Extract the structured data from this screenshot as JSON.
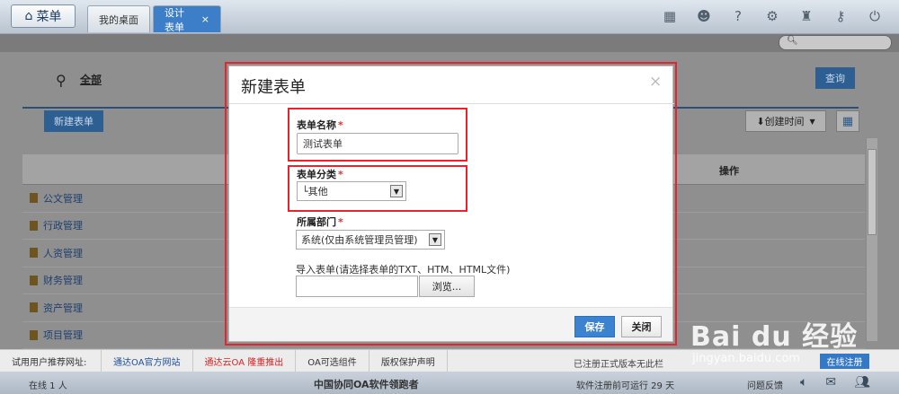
{
  "topbar": {
    "menu_label": "菜单",
    "tabs": [
      {
        "label": "我的桌面"
      },
      {
        "label": "设计表单",
        "close": "×"
      }
    ]
  },
  "search": {
    "placeholder": ""
  },
  "page": {
    "location_label": "全部",
    "query_button": "查询",
    "new_form_button": "新建表单",
    "sort_button": "创建时间",
    "table_header_operation": "操作",
    "categories": [
      "公文管理",
      "行政管理",
      "人资管理",
      "财务管理",
      "资产管理",
      "项目管理"
    ]
  },
  "modal": {
    "title": "新建表单",
    "close_glyph": "×",
    "form_name_label": "表单名称",
    "form_name_value": "测试表单",
    "form_category_label": "表单分类",
    "form_category_value": "└其他",
    "department_label": "所属部门",
    "department_value": "系统(仅由系统管理员管理)",
    "import_label": "导入表单(请选择表单的TXT、HTM、HTML文件)",
    "browse_button": "浏览...",
    "save_button": "保存",
    "close_button": "关闭",
    "required_mark": "*"
  },
  "footer": {
    "recommend_label": "试用用户推荐网址:",
    "links": [
      "通达OA官方网站",
      "通达云OA 隆重推出",
      "OA可选组件",
      "版权保护声明"
    ],
    "registered_note": "已注册正式版本无此栏",
    "register_button": "在线注册",
    "online_text": "在线 1 人",
    "brand_text": "中国协同OA软件领跑者",
    "days_text": "软件注册前可运行 29 天",
    "feedback_text": "问题反馈"
  },
  "watermark": {
    "logo_text": "Bai du 经验",
    "url": "jingyan.baidu.com"
  }
}
